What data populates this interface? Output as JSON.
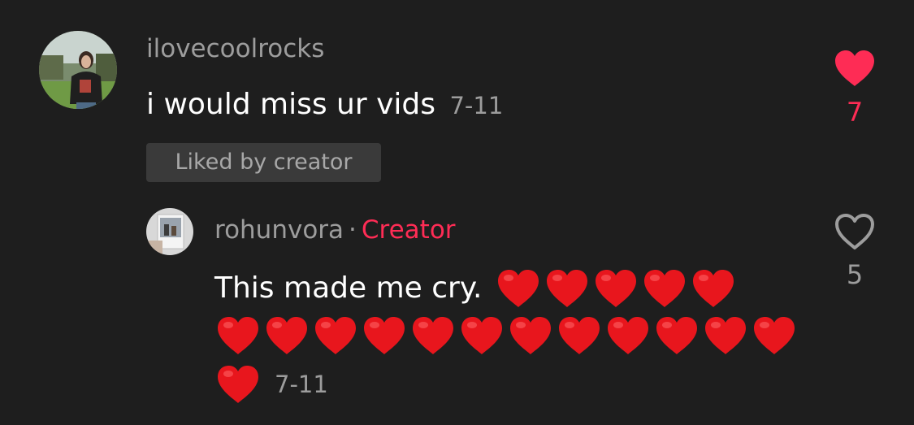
{
  "comment": {
    "username": "ilovecoolrocks",
    "text": "i would miss ur vids",
    "timestamp": "7-11",
    "liked_by_creator": "Liked by creator",
    "like_count": "7",
    "liked": true,
    "avatar_icon": "user-avatar-photo"
  },
  "reply": {
    "username": "rohunvora",
    "separator": "·",
    "creator_label": "Creator",
    "text": "This made me cry.",
    "heart_emoji_count": 18,
    "timestamp": "7-11",
    "like_count": "5",
    "liked": false,
    "avatar_icon": "user-avatar-photo"
  },
  "colors": {
    "background": "#1e1e1e",
    "accent": "#fe2c55",
    "muted_text": "#9d9d9d",
    "badge_bg": "#3a3a3a"
  }
}
